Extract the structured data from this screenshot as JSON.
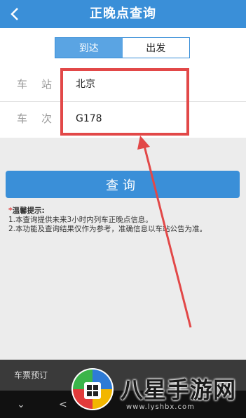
{
  "header": {
    "title": "正晚点查询",
    "back_icon": "chevron-left-icon"
  },
  "segment": {
    "arrive_label": "到达",
    "depart_label": "出发",
    "selected": "到达"
  },
  "form": {
    "station_label": "车站",
    "station_value": "北京",
    "train_label": "车次",
    "train_value": "G178"
  },
  "actions": {
    "query_label": "查询"
  },
  "tips": {
    "heading": "温馨提示:",
    "line1": "1.本查询提供未来3小时内列车正晚点信息。",
    "line2": "2.本功能及查询结果仅作为参考，准确信息以车站公告为准。"
  },
  "bottom": {
    "ticket_tab": "车票预订"
  },
  "watermark": {
    "text": "八星手游网",
    "url": "www.lyshbx.com"
  },
  "colors": {
    "accent": "#3a8fd8",
    "annotation": "#e24848"
  }
}
